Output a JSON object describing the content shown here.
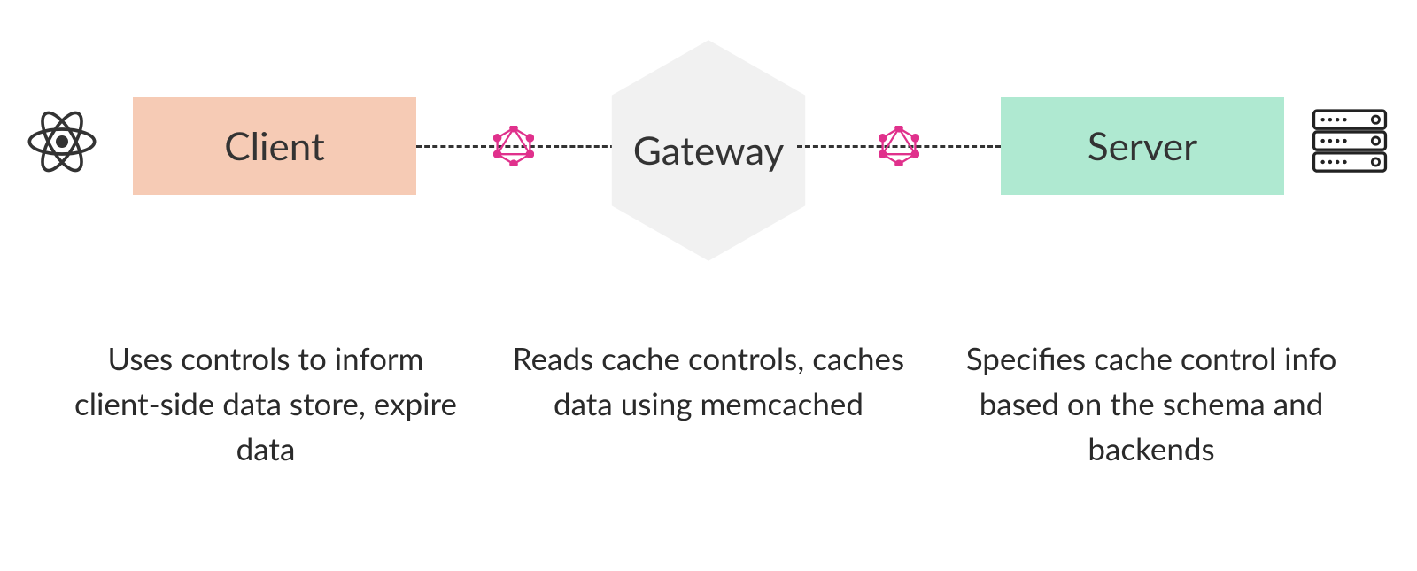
{
  "nodes": {
    "client": {
      "label": "Client",
      "description": "Uses controls to inform client-side data store, expire data",
      "color": "#f6cbb5"
    },
    "gateway": {
      "label": "Gateway",
      "description": "Reads cache controls, caches data using memcached",
      "color": "#f1f1f1"
    },
    "server": {
      "label": "Server",
      "description": "Specifies cache control info based on the schema and backends",
      "color": "#afe9d1"
    }
  },
  "icons": {
    "left": "react-icon",
    "right": "server-stack-icon",
    "connector": "graphql-icon"
  },
  "connectors": {
    "style": "dashed",
    "color": "#333333",
    "via_icon": "graphql-icon",
    "icon_color": "#e0318c"
  },
  "flow": [
    "client",
    "gateway",
    "server"
  ]
}
